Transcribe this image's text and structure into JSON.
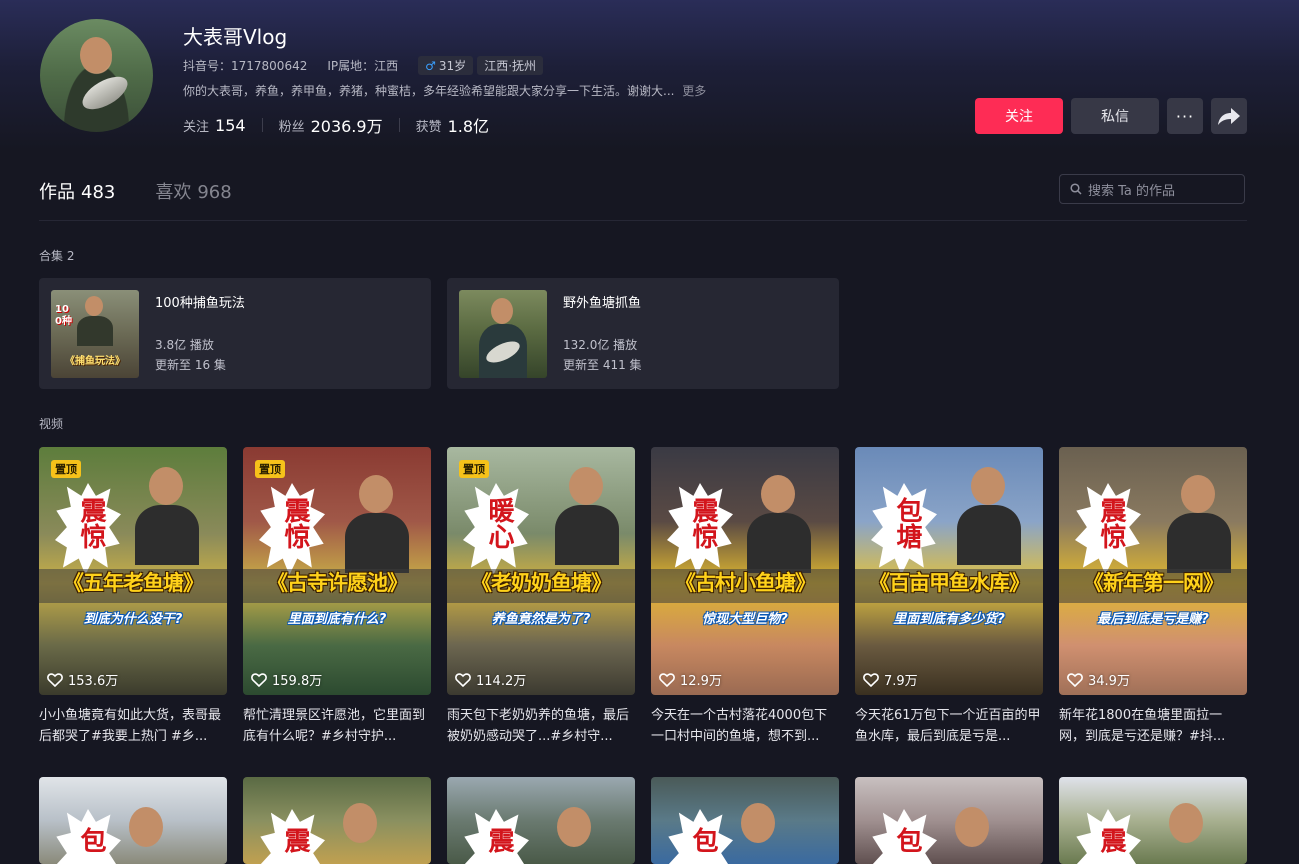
{
  "profile": {
    "name": "大表哥Vlog",
    "douyin_id": "抖音号：1717800642",
    "ip": "IP属地：江西",
    "age": "31岁",
    "location": "江西·抚州",
    "bio": "你的大表哥，养鱼，养甲鱼，养猪，种蜜桔，多年经验希望能跟大家分享一下生活。谢谢大...",
    "bio_more": "更多",
    "following_label": "关注",
    "following": "154",
    "followers_label": "粉丝",
    "followers": "2036.9万",
    "likes_label": "获赞",
    "likes": "1.8亿"
  },
  "actions": {
    "follow": "关注",
    "message": "私信",
    "more": "···"
  },
  "tabs": [
    {
      "label": "作品",
      "count": "483"
    },
    {
      "label": "喜欢",
      "count": "968"
    }
  ],
  "search": {
    "placeholder": "搜索 Ta 的作品"
  },
  "collections_label": "合集 2",
  "collections": [
    {
      "title": "100种捕鱼玩法",
      "plays": "3.8亿 播放",
      "episodes": "更新至 16 集",
      "thumb_text": "100种",
      "thumb_sub": "《捕鱼玩法》"
    },
    {
      "title": "野外鱼塘抓鱼",
      "plays": "132.0亿 播放",
      "episodes": "更新至 411 集"
    }
  ],
  "videos_label": "视频",
  "videos": [
    {
      "pinned": "置顶",
      "burst": "震惊",
      "title": "《五年老鱼塘》",
      "subtitle": "到底为什么没干?",
      "likes": "153.6万",
      "desc": "小小鱼塘竟有如此大货，表哥最后都哭了#我要上热门 #乡..."
    },
    {
      "pinned": "置顶",
      "burst": "震惊",
      "title": "《古寺许愿池》",
      "subtitle": "里面到底有什么?",
      "likes": "159.8万",
      "desc": "帮忙清理景区许愿池，它里面到底有什么呢？#乡村守护..."
    },
    {
      "pinned": "置顶",
      "burst": "暖心",
      "title": "《老奶奶鱼塘》",
      "subtitle": "养鱼竟然是为了?",
      "likes": "114.2万",
      "desc": "雨天包下老奶奶养的鱼塘，最后被奶奶感动哭了...#乡村守..."
    },
    {
      "pinned": "",
      "burst": "震惊",
      "title": "《古村小鱼塘》",
      "subtitle": "惊现大型巨物?",
      "likes": "12.9万",
      "desc": "今天在一个古村落花4000包下一口村中间的鱼塘，想不到..."
    },
    {
      "pinned": "",
      "burst": "包塘",
      "title": "《百亩甲鱼水库》",
      "subtitle": "里面到底有多少货?",
      "likes": "7.9万",
      "desc": "今天花61万包下一个近百亩的甲鱼水库，最后到底是亏是..."
    },
    {
      "pinned": "",
      "burst": "震惊",
      "title": "《新年第一网》",
      "subtitle": "最后到底是亏是赚?",
      "likes": "34.9万",
      "desc": "新年花1800在鱼塘里面拉一网，到底是亏还是赚？#抖..."
    }
  ],
  "second_row_bursts": [
    "包",
    "震",
    "震",
    "包",
    "包",
    "震"
  ],
  "colors": {
    "accent": "#fe2c55",
    "pin": "#f6c21a",
    "bg": "#161722"
  }
}
